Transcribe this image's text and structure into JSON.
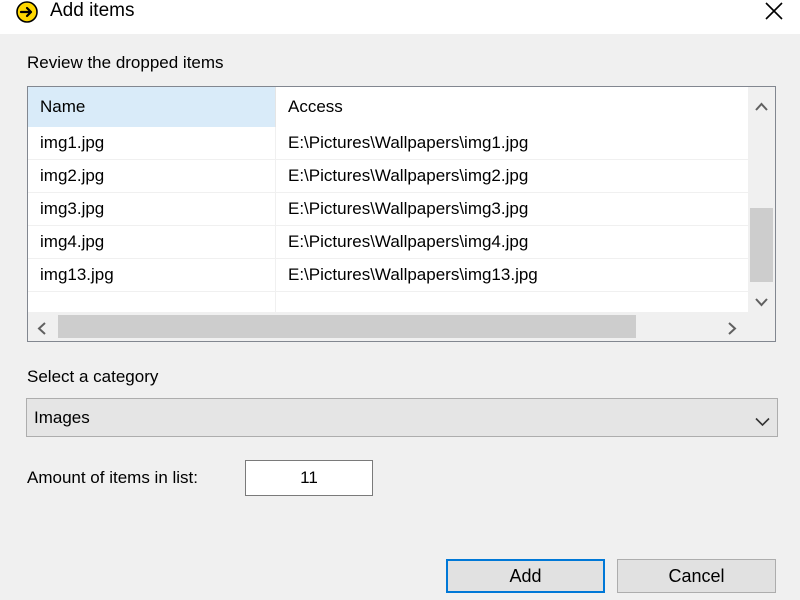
{
  "window": {
    "title": "Add items",
    "icon": "arrow-circle-icon",
    "close_icon": "close-icon"
  },
  "review": {
    "label": "Review the dropped items",
    "columns": [
      "Name",
      "Access"
    ],
    "rows": [
      {
        "name": "img1.jpg",
        "access": "E:\\Pictures\\Wallpapers\\img1.jpg"
      },
      {
        "name": "img2.jpg",
        "access": "E:\\Pictures\\Wallpapers\\img2.jpg"
      },
      {
        "name": "img3.jpg",
        "access": "E:\\Pictures\\Wallpapers\\img3.jpg"
      },
      {
        "name": "img4.jpg",
        "access": "E:\\Pictures\\Wallpapers\\img4.jpg"
      },
      {
        "name": "img13.jpg",
        "access": "E:\\Pictures\\Wallpapers\\img13.jpg"
      }
    ]
  },
  "category": {
    "label": "Select a category",
    "selected": "Images"
  },
  "amount": {
    "label": "Amount of items in list:",
    "value": "11"
  },
  "buttons": {
    "add": "Add",
    "cancel": "Cancel"
  },
  "colors": {
    "accent": "#0078d7",
    "header_selected": "#d9ebf9",
    "icon_yellow": "#ffd700"
  }
}
